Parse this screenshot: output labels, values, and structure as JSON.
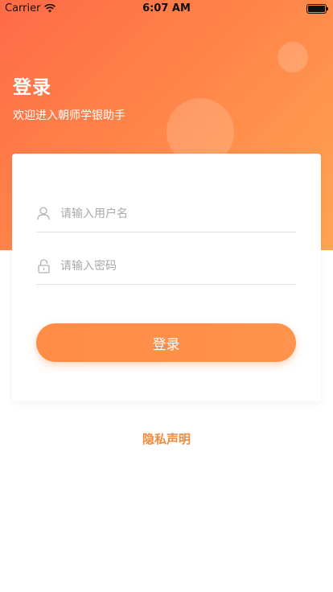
{
  "status_bar": {
    "carrier": "Carrier",
    "time": "6:07 AM"
  },
  "header": {
    "title": "登录",
    "subtitle": "欢迎进入朝师学银助手"
  },
  "form": {
    "username_placeholder": "请输入用户名",
    "username_value": "",
    "password_placeholder": "请输入密码",
    "password_value": "",
    "login_label": "登录"
  },
  "footer": {
    "privacy_label": "隐私声明"
  },
  "colors": {
    "accent": "#ff8c45",
    "gradient_start": "#ff6a47",
    "gradient_end": "#ffa552",
    "link": "#f08a3c"
  },
  "icons": {
    "username": "user-icon",
    "password": "lock-icon",
    "wifi": "wifi-icon",
    "battery": "battery-icon"
  }
}
